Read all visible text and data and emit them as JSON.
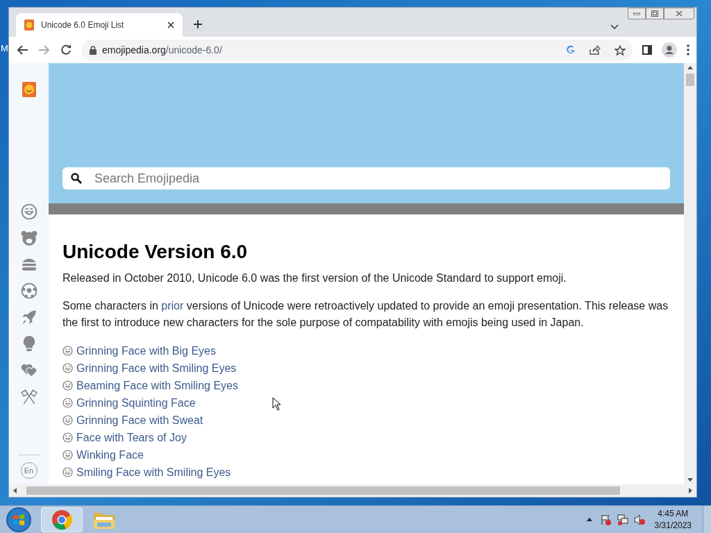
{
  "desktop": {
    "icon_label": "M"
  },
  "browser": {
    "tabs": [
      {
        "title": "Unicode 6.0 Emoji List",
        "selected": true
      }
    ],
    "url_host": "emojipedia.org",
    "url_path": "/unicode-6.0/"
  },
  "page": {
    "search": {
      "placeholder": "Search Emojipedia"
    },
    "heading": "Unicode Version 6.0",
    "intro": "Released in October 2010, Unicode 6.0 was the first version of the Unicode Standard to support emoji.",
    "paragraph": {
      "before": "Some characters in",
      "link": "prior",
      "after": "versions of Unicode were retroactively updated to provide an emoji presentation. This release was the first to introduce new characters for the sole purpose of compatability with emojis being used in Japan."
    },
    "emoji_list": [
      {
        "name": "Grinning Face with Big Eyes"
      },
      {
        "name": "Grinning Face with Smiling Eyes"
      },
      {
        "name": "Beaming Face with Smiling Eyes"
      },
      {
        "name": "Grinning Squinting Face"
      },
      {
        "name": "Grinning Face with Sweat"
      },
      {
        "name": "Face with Tears of Joy"
      },
      {
        "name": "Winking Face"
      },
      {
        "name": "Smiling Face with Smiling Eyes"
      }
    ],
    "language": "En"
  },
  "taskbar": {
    "time": "4:45 AM",
    "date": "3/31/2023"
  }
}
